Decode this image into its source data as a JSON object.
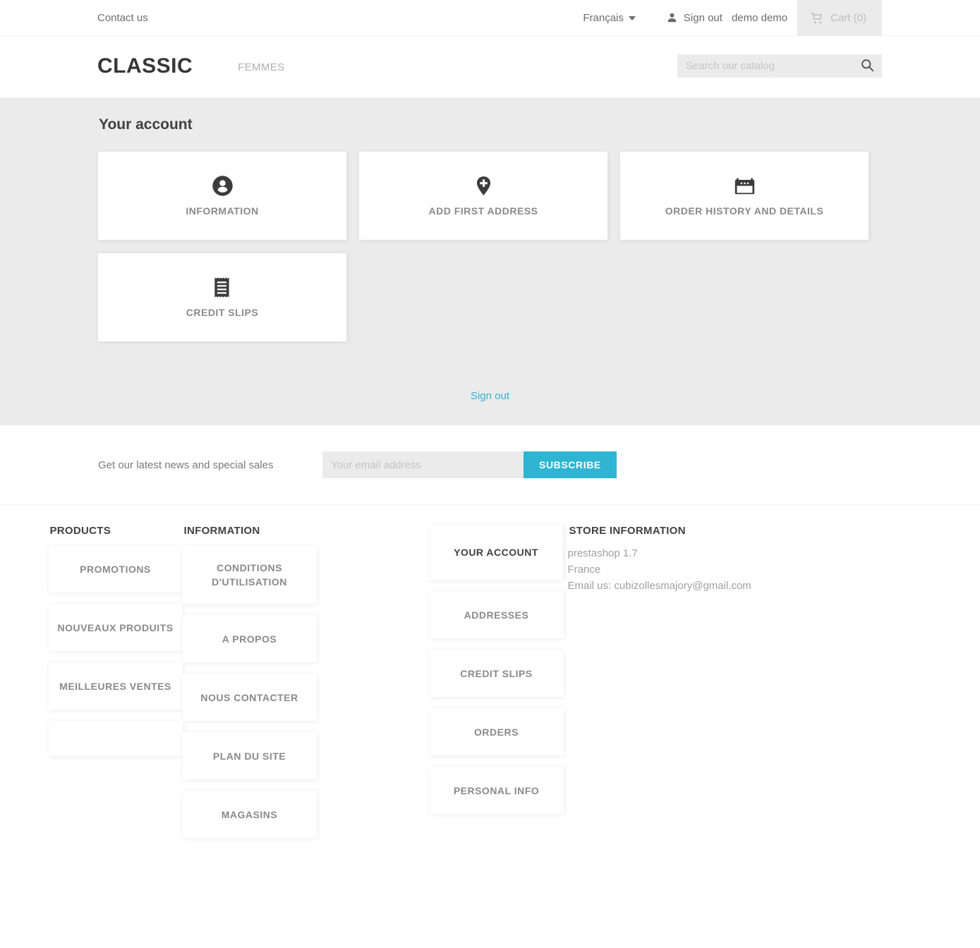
{
  "topnav": {
    "contact_label": "Contact us",
    "language": "Français",
    "signout_label": "Sign out",
    "user_name": "demo demo",
    "cart_label": "Cart (0)",
    "icons": {
      "user": "user-icon",
      "cart": "shopping-cart-icon",
      "caret": "chevron-down-icon"
    }
  },
  "header": {
    "logo": "CLASSIC",
    "menu": [
      {
        "label": "FEMMES"
      }
    ],
    "search": {
      "placeholder": "Search our catalog",
      "value": "",
      "icon": "search-icon"
    }
  },
  "account": {
    "title": "Your account",
    "cards": [
      {
        "label": "INFORMATION",
        "icon": "account-circle-icon"
      },
      {
        "label": "ADD FIRST ADDRESS",
        "icon": "map-pin-plus-icon"
      },
      {
        "label": "ORDER HISTORY AND DETAILS",
        "icon": "calendar-icon"
      },
      {
        "label": "CREDIT SLIPS",
        "icon": "receipt-icon"
      }
    ],
    "signout_label": "Sign out",
    "signout_color": "#2fb5d2"
  },
  "newsletter": {
    "text": "Get our latest news and special sales",
    "placeholder": "Your email address",
    "value": "",
    "button_label": "SUBSCRIBE",
    "button_color": "#2fb5d2"
  },
  "footer": {
    "products": {
      "title": "PRODUCTS",
      "items": [
        {
          "label": "PROMOTIONS",
          "size": "normal"
        },
        {
          "label": "NOUVEAUX PRODUITS",
          "size": "normal"
        },
        {
          "label": "MEILLEURES VENTES",
          "size": "normal"
        },
        {
          "label": "",
          "size": "empty"
        }
      ]
    },
    "information": {
      "title": "INFORMATION",
      "items": [
        {
          "label": "CONDITIONS D'UTILISATION",
          "size": "tall"
        },
        {
          "label": "A PROPOS",
          "size": "normal"
        },
        {
          "label": "NOUS CONTACTER",
          "size": "normal"
        },
        {
          "label": "PLAN DU SITE",
          "size": "normal"
        },
        {
          "label": "MAGASINS",
          "size": "normal"
        }
      ]
    },
    "account": {
      "items": [
        {
          "label": "YOUR ACCOUNT",
          "head": true
        },
        {
          "label": "ADDRESSES",
          "head": false
        },
        {
          "label": "CREDIT SLIPS",
          "head": false
        },
        {
          "label": "ORDERS",
          "head": false
        },
        {
          "label": "PERSONAL INFO",
          "head": false
        }
      ]
    },
    "store": {
      "title": "STORE INFORMATION",
      "lines": [
        "prestashop 1.7",
        "France",
        "Email us: cubizollesmajory@gmail.com"
      ]
    }
  }
}
